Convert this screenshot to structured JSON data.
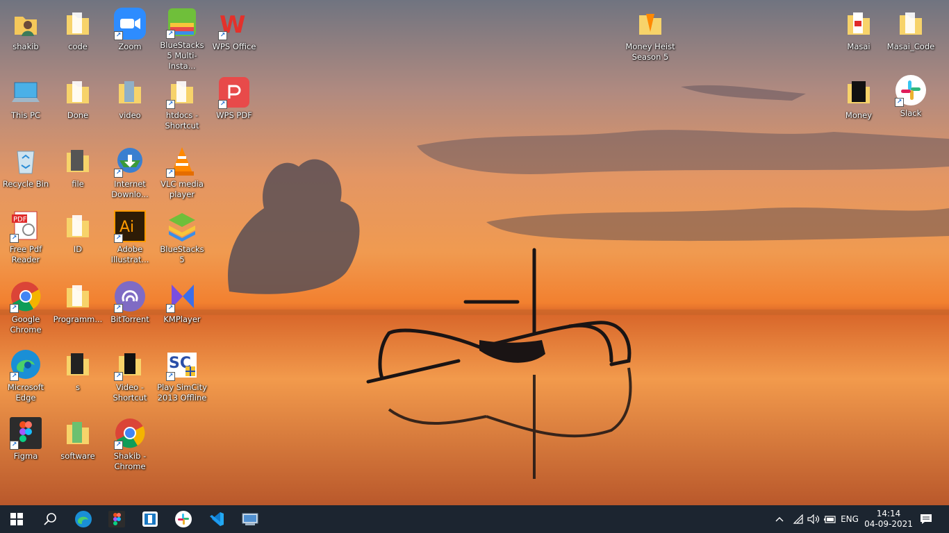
{
  "desktop": {
    "icons": [
      {
        "label": "shakib",
        "icon": "user-folder-icon"
      },
      {
        "label": "code",
        "icon": "folder-icon"
      },
      {
        "label": "Zoom",
        "icon": "zoom-icon"
      },
      {
        "label": "BlueStacks 5 Multi-Insta...",
        "icon": "bluestacks-multi-icon"
      },
      {
        "label": "WPS Office",
        "icon": "wps-office-icon"
      },
      {
        "label": "This PC",
        "icon": "computer-icon"
      },
      {
        "label": "Done",
        "icon": "folder-icon"
      },
      {
        "label": "video",
        "icon": "folder-icon"
      },
      {
        "label": "htdocs - Shortcut",
        "icon": "folder-icon"
      },
      {
        "label": "WPS PDF",
        "icon": "wps-pdf-icon"
      },
      {
        "label": "Recycle Bin",
        "icon": "recycle-bin-icon"
      },
      {
        "label": "file",
        "icon": "folder-icon"
      },
      {
        "label": "Internet Downlo...",
        "icon": "idm-icon"
      },
      {
        "label": "VLC media player",
        "icon": "vlc-icon"
      },
      {
        "label": "Free Pdf Reader",
        "icon": "pdf-reader-icon"
      },
      {
        "label": "ID",
        "icon": "folder-icon"
      },
      {
        "label": "Adobe Illustrat...",
        "icon": "illustrator-icon"
      },
      {
        "label": "BlueStacks 5",
        "icon": "bluestacks-icon"
      },
      {
        "label": "Google Chrome",
        "icon": "chrome-icon"
      },
      {
        "label": "Programm...",
        "icon": "folder-icon"
      },
      {
        "label": "BitTorrent",
        "icon": "bittorrent-icon"
      },
      {
        "label": "KMPlayer",
        "icon": "kmplayer-icon"
      },
      {
        "label": "Microsoft Edge",
        "icon": "edge-icon"
      },
      {
        "label": "s",
        "icon": "folder-icon"
      },
      {
        "label": "Video - Shortcut",
        "icon": "folder-icon"
      },
      {
        "label": "Play SimCity 2013 Offline",
        "icon": "simcity-icon"
      },
      {
        "label": "Figma",
        "icon": "figma-icon"
      },
      {
        "label": "software",
        "icon": "folder-icon"
      },
      {
        "label": "Shakib - Chrome",
        "icon": "chrome-icon"
      },
      {
        "label": "Money Heist Season 5",
        "icon": "folder-icon"
      },
      {
        "label": "Masai",
        "icon": "folder-icon"
      },
      {
        "label": "Masai_Code",
        "icon": "folder-icon"
      },
      {
        "label": "Money",
        "icon": "folder-icon"
      },
      {
        "label": "Slack",
        "icon": "slack-icon"
      }
    ]
  },
  "taskbar": {
    "pinned": [
      "windows-start-icon",
      "search-icon",
      "edge-icon",
      "figma-icon",
      "app-icon",
      "slack-icon",
      "vscode-icon",
      "control-panel-icon"
    ],
    "tray": {
      "language": "ENG",
      "time": "14:14",
      "date": "04-09-2021"
    },
    "colors": {
      "background": "#1c2530"
    }
  }
}
